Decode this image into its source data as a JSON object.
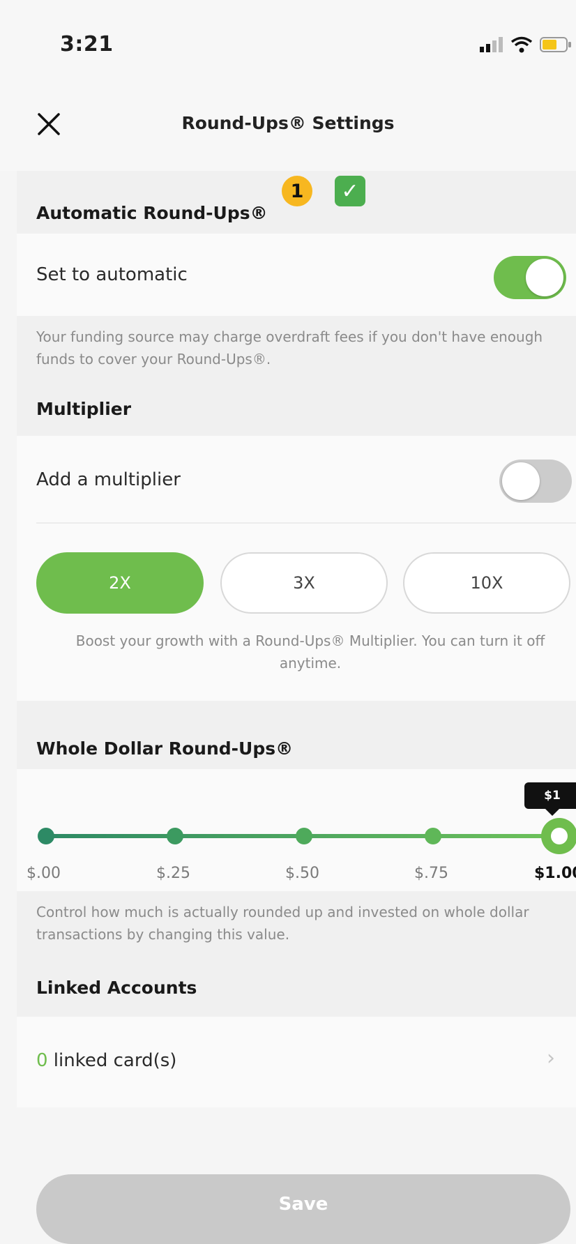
{
  "status": {
    "time": "3:21"
  },
  "nav": {
    "title": "Round-Ups® Settings"
  },
  "badges": {
    "step_number": "1",
    "check": "✓"
  },
  "automatic": {
    "header": "Automatic Round-Ups®",
    "toggle_label": "Set to automatic",
    "toggle_on": true,
    "note": "Your funding source may charge overdraft fees if you don't have enough funds to cover your Round-Ups®."
  },
  "multiplier": {
    "header": "Multiplier",
    "toggle_label": "Add a multiplier",
    "toggle_on": false,
    "options": [
      "2X",
      "3X",
      "10X"
    ],
    "selected": "2X",
    "note": "Boost your growth with a Round-Ups® Multiplier. You can turn it off anytime."
  },
  "whole_dollar": {
    "header": "Whole Dollar Round-Ups®",
    "tooltip": "$1",
    "ticks": [
      "$.00",
      "$.25",
      "$.50",
      "$.75",
      "$1.00"
    ],
    "selected": "$1.00",
    "note": "Control how much is actually rounded up and invested on whole dollar transactions by changing this value."
  },
  "linked": {
    "header": "Linked Accounts",
    "count": "0",
    "label": " linked card(s)",
    "chevron": "›"
  },
  "save_label": "Save",
  "colors": {
    "accent": "#6fbd4d",
    "slider_start": "#2d8a65",
    "badge": "#f7b720",
    "check": "#4cae4f"
  }
}
